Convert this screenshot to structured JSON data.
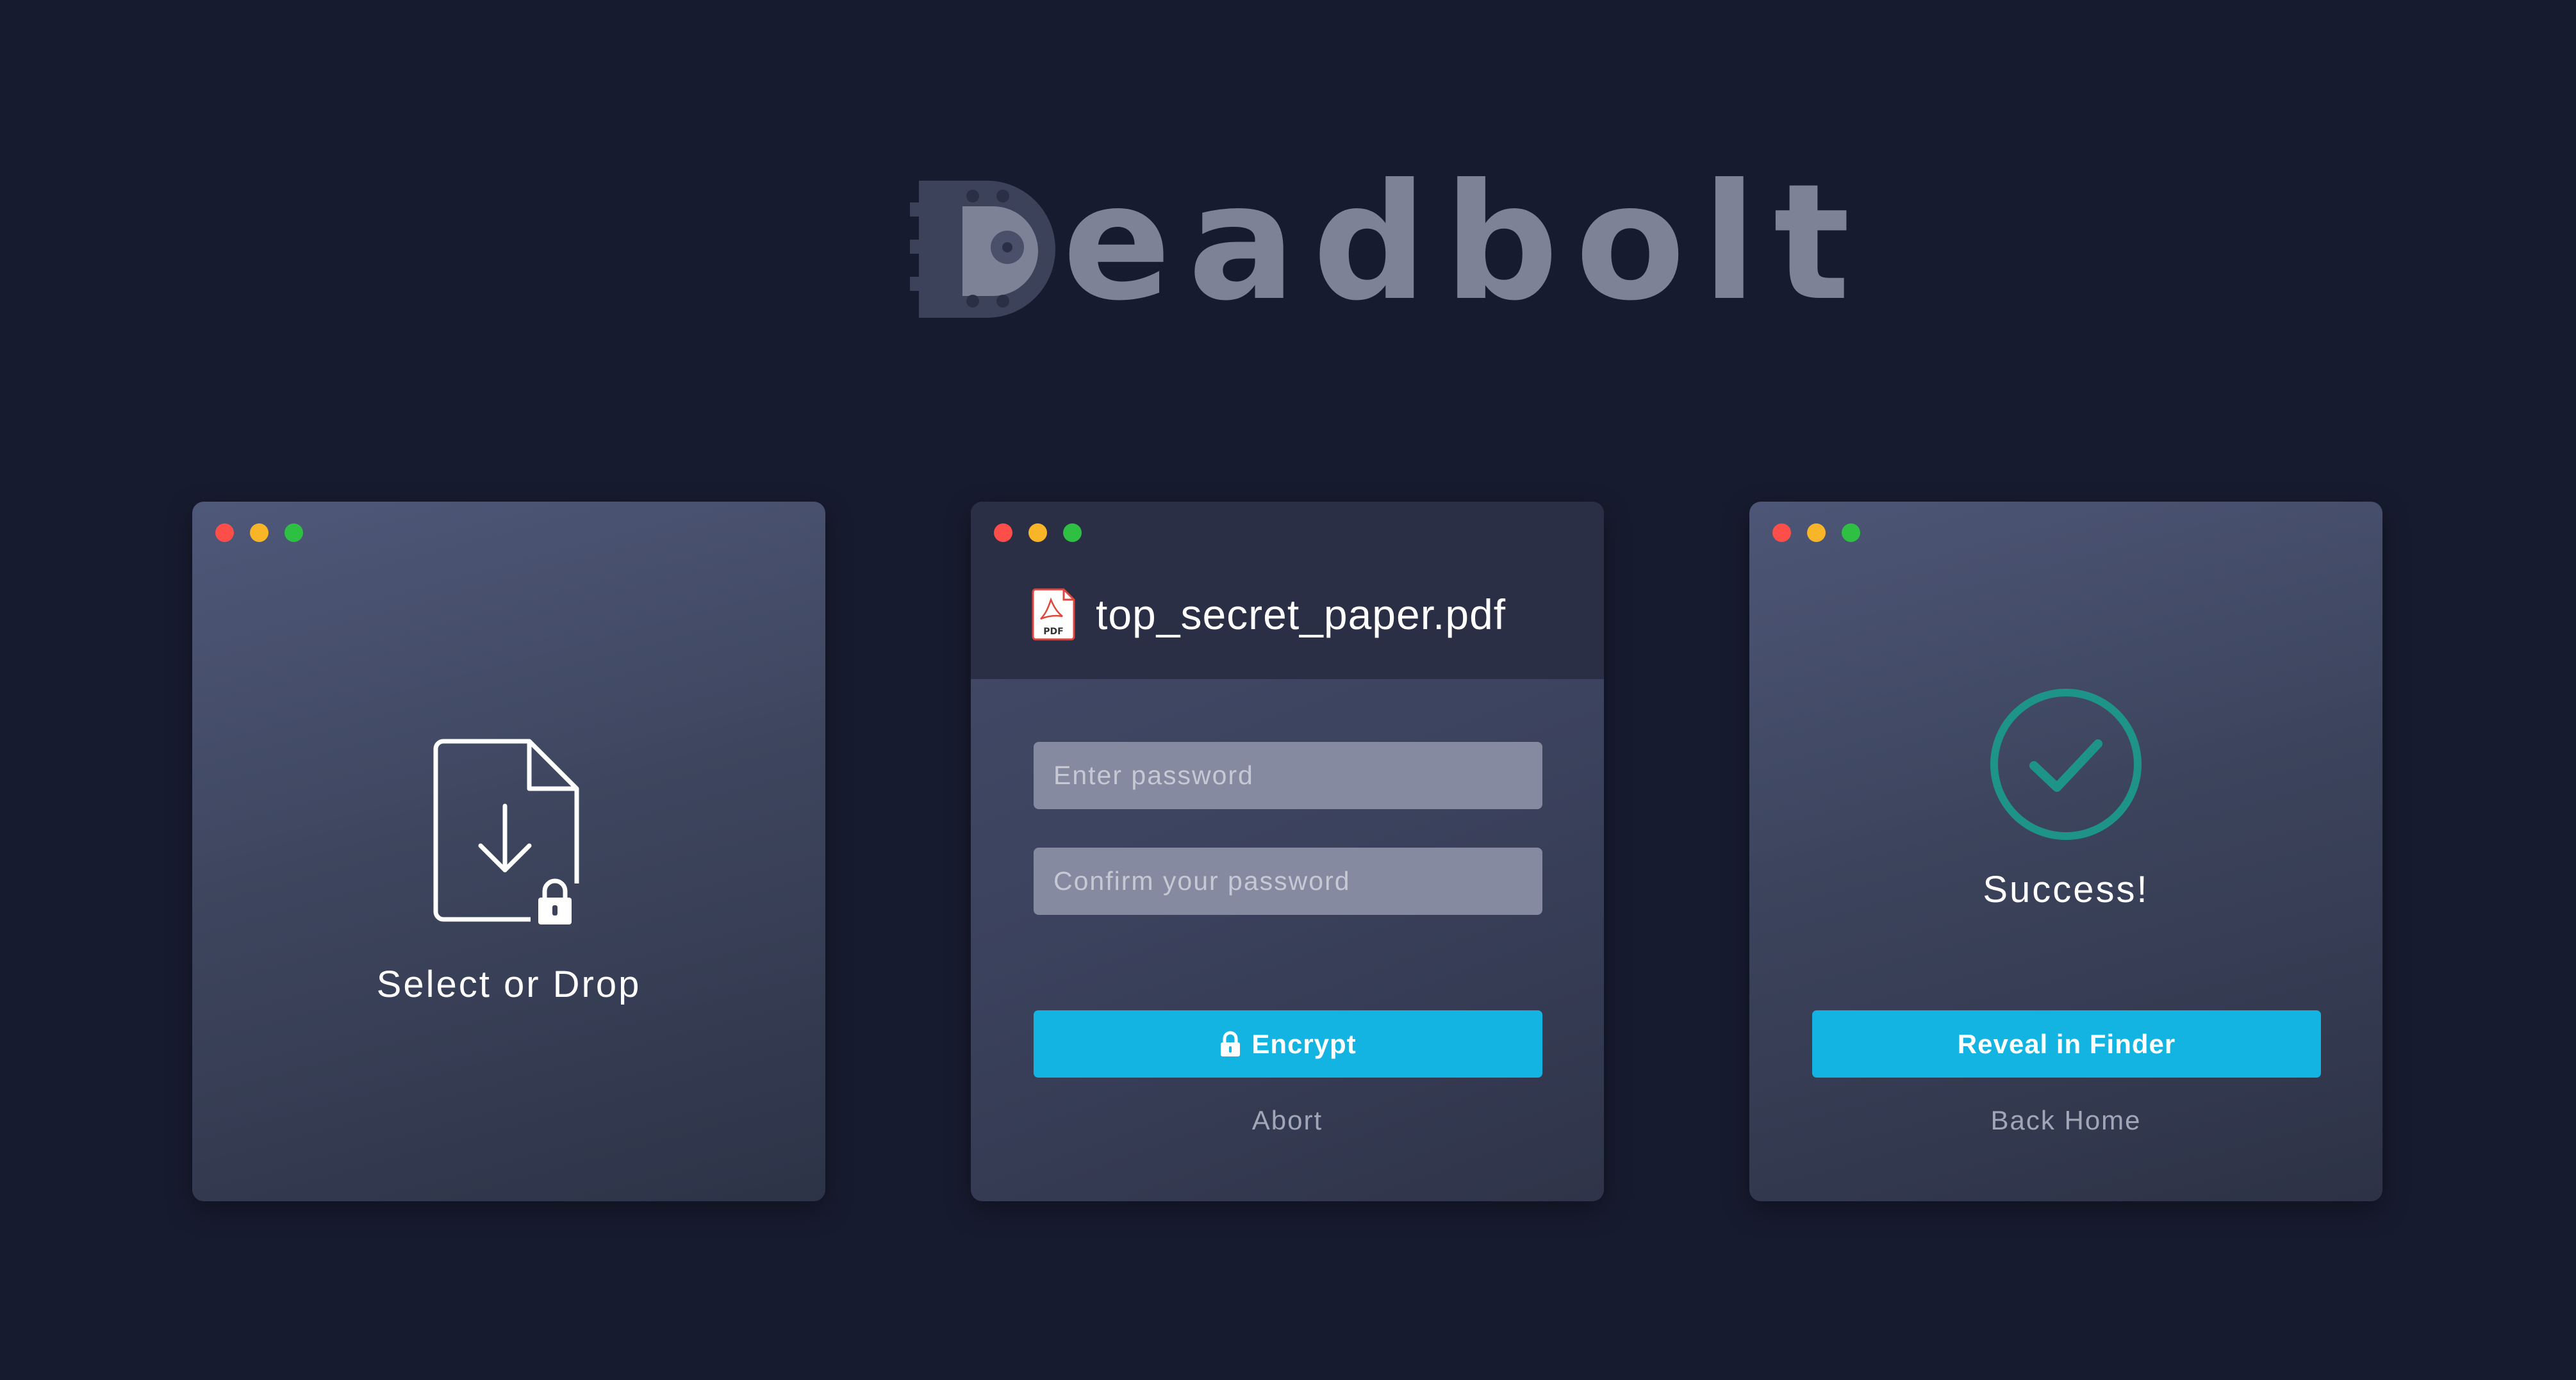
{
  "logo": {
    "text": "eadbolt",
    "mark_letter": "D"
  },
  "colors": {
    "background": "#171b2f",
    "accent": "#13b3e2",
    "success": "#1e9488",
    "logo": "#7e8296",
    "close": "#fd4e4a",
    "minimize": "#f8b527",
    "zoom": "#2dc042"
  },
  "select_window": {
    "label": "Select or Drop",
    "icon": "file-download-lock-icon"
  },
  "encrypt_window": {
    "file_name": "top_secret_paper.pdf",
    "file_icon": "pdf-file-icon",
    "file_icon_label": "PDF",
    "password_placeholder": "Enter password",
    "confirm_placeholder": "Confirm your password",
    "encrypt_label": "Encrypt",
    "abort_label": "Abort"
  },
  "success_window": {
    "label": "Success!",
    "icon": "check-circle-icon",
    "reveal_label": "Reveal in Finder",
    "back_label": "Back Home"
  }
}
